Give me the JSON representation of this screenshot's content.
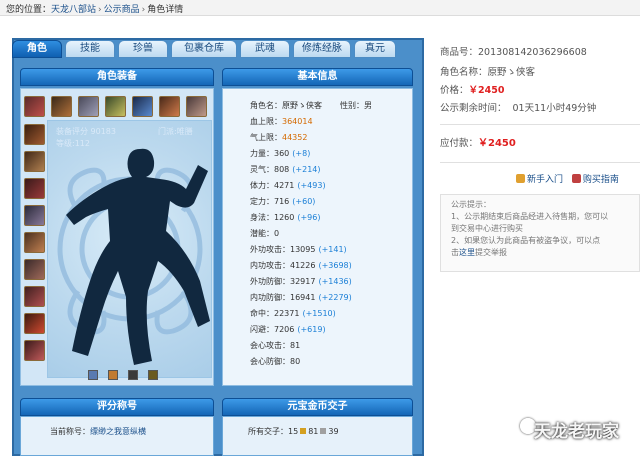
{
  "breadcrumb": {
    "prefix": "您的位置：",
    "site": "天龙八部站",
    "sep": "›",
    "listing": "公示商品",
    "current": "角色详情"
  },
  "tabs": [
    {
      "label": "角色",
      "active": true
    },
    {
      "label": "技能",
      "active": false
    },
    {
      "label": "珍兽",
      "active": false
    },
    {
      "label": "包裹仓库",
      "active": false
    },
    {
      "label": "武魂",
      "active": false
    },
    {
      "label": "修炼经脉",
      "active": false
    },
    {
      "label": "真元",
      "active": false
    }
  ],
  "equip": {
    "header": "角色装备",
    "score_text": "装备评分 90183",
    "menpai_text": "门派:唯膳",
    "level_text": "等级:112"
  },
  "base_info": {
    "header": "基本信息",
    "role_label": "角色名：",
    "role_name": "原野ゝ侠客",
    "gender_label": "性别：",
    "gender": "男",
    "hp_label": "血上限：",
    "hp": "364014",
    "mp_label": "气上限：",
    "mp": "44352",
    "stats": [
      {
        "label": "力量：",
        "value": "360",
        "bonus": "(+8)"
      },
      {
        "label": "灵气：",
        "value": "808",
        "bonus": "(+214)"
      },
      {
        "label": "体力：",
        "value": "4271",
        "bonus": "(+493)"
      },
      {
        "label": "定力：",
        "value": "716",
        "bonus": "(+60)"
      },
      {
        "label": "身法：",
        "value": "1260",
        "bonus": "(+96)"
      },
      {
        "label": "潜能：",
        "value": "0",
        "bonus": ""
      },
      {
        "label": "外功攻击：",
        "value": "13095",
        "bonus": "(+141)"
      },
      {
        "label": "内功攻击：",
        "value": "41226",
        "bonus": "(+3698)"
      },
      {
        "label": "外功防御：",
        "value": "32917",
        "bonus": "(+1436)"
      },
      {
        "label": "内功防御：",
        "value": "16941",
        "bonus": "(+2279)"
      },
      {
        "label": "命中：",
        "value": "22371",
        "bonus": "(+1510)"
      },
      {
        "label": "闪避：",
        "value": "7206",
        "bonus": "(+619)"
      },
      {
        "label": "会心攻击：",
        "value": "81",
        "bonus": ""
      },
      {
        "label": "会心防御：",
        "value": "80",
        "bonus": ""
      }
    ]
  },
  "score_panel": {
    "header": "评分称号",
    "title_label": "当前称号：",
    "title_value": "缥缈之我意纵横"
  },
  "gold_panel": {
    "header": "元宝金币交子",
    "label": "所有交子：",
    "value_a": "15",
    "value_b": "81",
    "value_c": "39"
  },
  "product": {
    "id_label": "商品号：",
    "id": "201308142036296608",
    "role_label": "角色名称：",
    "role": "原野ゝ侠客",
    "price_label": "价格：",
    "price": "￥2450",
    "remain_label": "公示剩余时间：",
    "remain": "01天11小时49分钟",
    "pay_label": "应付款：",
    "pay": "￥2450"
  },
  "links": {
    "newbie": "新手入门",
    "guide": "购买指南"
  },
  "notice": {
    "title": "公示提示：",
    "line1": "1、公示期结束后商品经进入待售期，您可以",
    "line2": "到交易中心进行购买",
    "line3": "2、如果您认为此商品有被盗争议，可以点",
    "line4_a": "击这里",
    "line4_em": "这里",
    "line4_b": "提交举报"
  },
  "watermark": "天龙老玩家",
  "colors": {
    "accent": "#1466b6",
    "price": "#e02020",
    "bonus": "#1b7fd6",
    "hp": "#d46a00"
  }
}
